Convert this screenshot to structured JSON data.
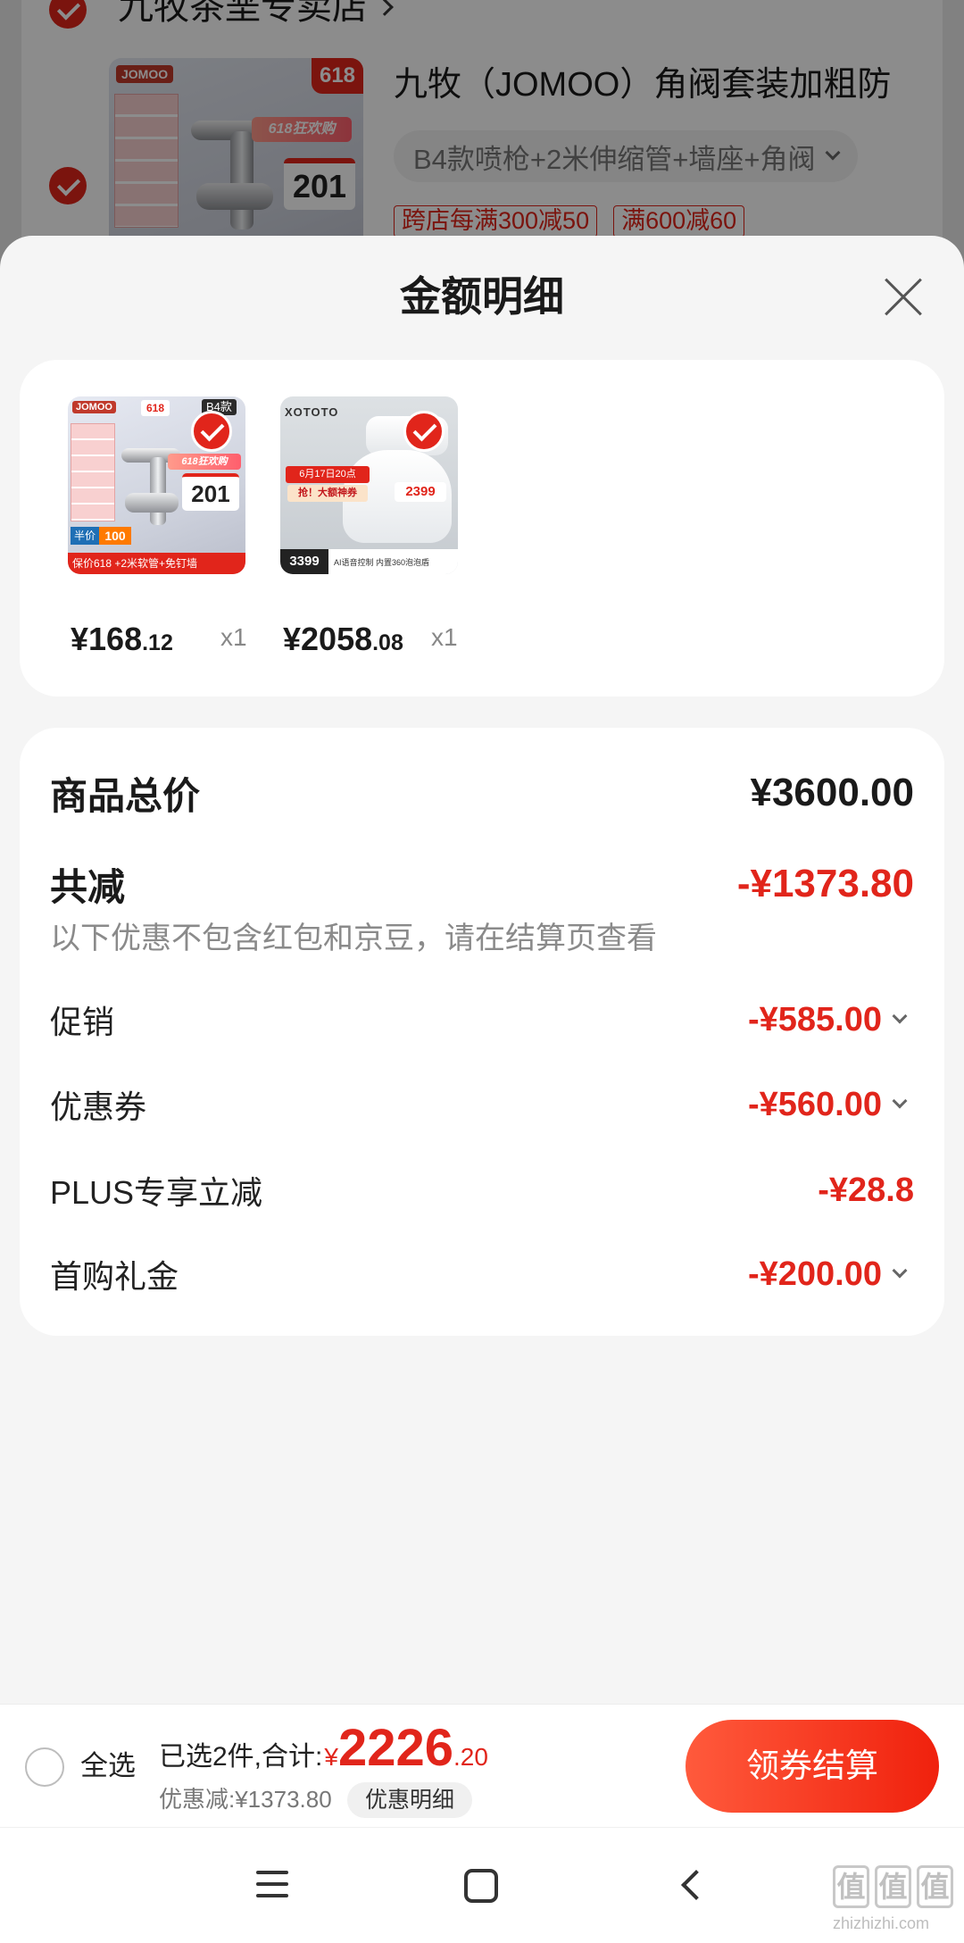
{
  "colors": {
    "accent": "#e1251b",
    "button_start": "#ff5a3c",
    "button_end": "#f0210d",
    "sheet_bg": "#f5f5f5",
    "card_bg": "#ffffff",
    "muted_text": "#8a8a8a"
  },
  "background_cart": {
    "store_name": "九牧茶垩专卖店",
    "store_checked": true,
    "product": {
      "checked": true,
      "title": "九牧（JOMOO）角阀套装加粗防",
      "variant": "B4款喷枪+2米伸缩管+墙座+角阀",
      "tags": [
        "跨店每满300减50",
        "满600减60"
      ],
      "image": {
        "logo": "JOMOO",
        "badge": "618",
        "banner": "618狂欢购",
        "price": "201"
      }
    }
  },
  "sheet": {
    "title": "金额明细",
    "items": [
      {
        "checked": true,
        "price_int": "¥168",
        "price_dec": ".12",
        "qty": "x1",
        "image": {
          "logo": "JOMOO",
          "badge": "618",
          "variant_tag": "B4款",
          "banner": "618狂欢购",
          "price": "201",
          "half_label": "半价",
          "half_value": "100",
          "strip": "保价618 +2米软管+免钉墙"
        }
      },
      {
        "checked": true,
        "price_int": "¥2058",
        "price_dec": ".08",
        "qty": "x1",
        "image": {
          "logo": "XOTOTO",
          "date": "6月17日20点",
          "coupon": "抢！大额神券",
          "promo_price": "2399",
          "price": "3399",
          "strip": "AI语音控制 内置360泡泡盾"
        }
      }
    ],
    "details": {
      "total": {
        "label": "商品总价",
        "value": "¥3600.00"
      },
      "discount": {
        "label": "共减",
        "value": "-¥1373.80"
      },
      "note": "以下优惠不包含红包和京豆，请在结算页查看",
      "rows": [
        {
          "label": "促销",
          "value": "-¥585.00",
          "expandable": true
        },
        {
          "label": "优惠券",
          "value": "-¥560.00",
          "expandable": true
        },
        {
          "label": "PLUS专享立减",
          "value": "-¥28.8",
          "expandable": false
        },
        {
          "label": "首购礼金",
          "value": "-¥200.00",
          "expandable": true
        }
      ]
    }
  },
  "bottom_bar": {
    "select_all_label": "全选",
    "select_all_checked": false,
    "selected_text": "已选2件,合计:",
    "currency": "¥",
    "total_int": "2226",
    "total_dec": ".20",
    "saved_text": "优惠减:¥1373.80",
    "detail_button": "优惠明细",
    "checkout_button": "领券结算"
  },
  "nav_bar": {
    "icons": [
      "menu-icon",
      "home-icon",
      "back-icon"
    ]
  },
  "watermark": {
    "logo_chars": [
      "值",
      "值",
      "值"
    ],
    "site": "zhizhizhi.com"
  }
}
